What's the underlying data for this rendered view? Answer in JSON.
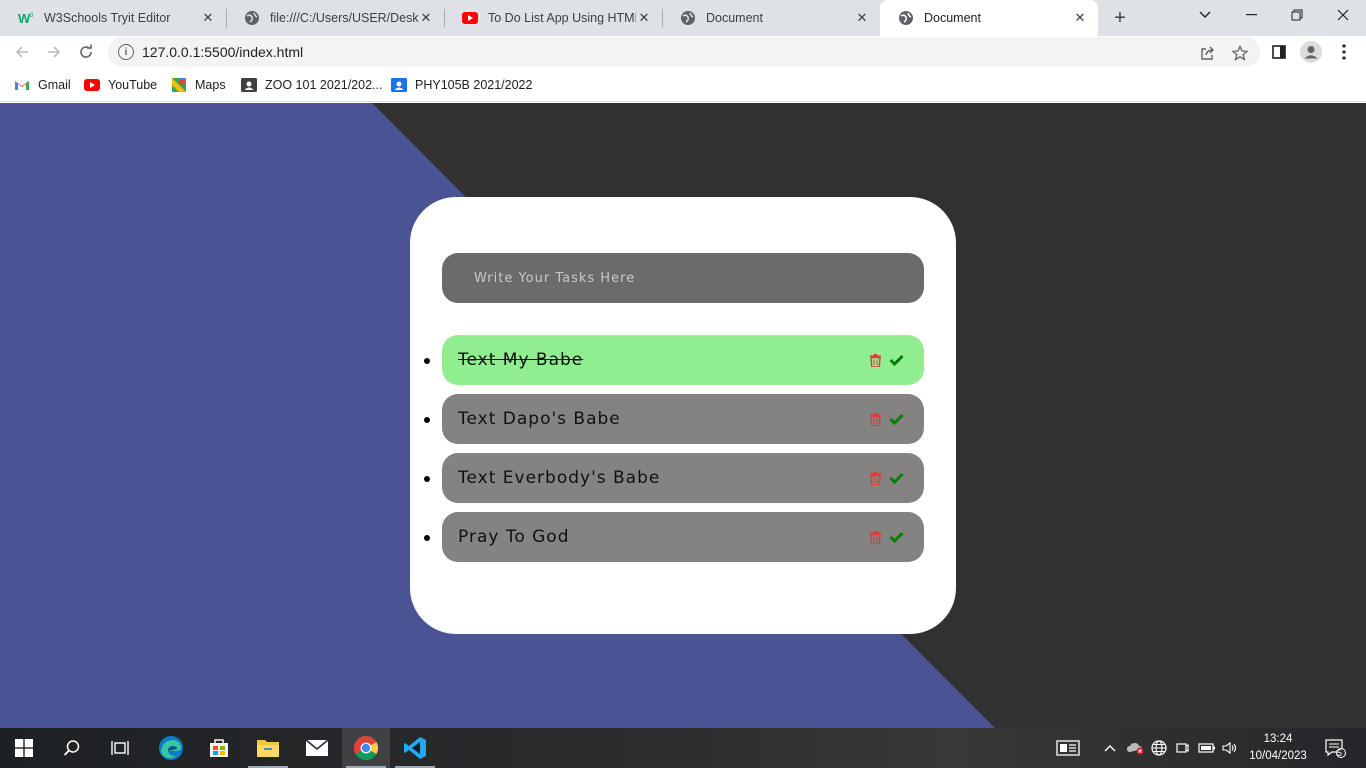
{
  "browser": {
    "tabs": [
      {
        "title": "W3Schools Tryit Editor",
        "icon": "w3schools-icon"
      },
      {
        "title": "file:///C:/Users/USER/Desktop",
        "icon": "globe-icon"
      },
      {
        "title": "To Do List App Using HTML",
        "icon": "youtube-icon"
      },
      {
        "title": "Document",
        "icon": "globe-icon"
      },
      {
        "title": "Document",
        "icon": "globe-icon"
      }
    ],
    "url": "127.0.0.1:5500/index.html",
    "bookmarks": [
      {
        "label": "Gmail",
        "icon": "gmail-icon"
      },
      {
        "label": "YouTube",
        "icon": "youtube-icon"
      },
      {
        "label": "Maps",
        "icon": "maps-icon"
      },
      {
        "label": "ZOO 101 2021/202...",
        "icon": "classroom-icon"
      },
      {
        "label": "PHY105B 2021/2022",
        "icon": "classroom-icon"
      }
    ]
  },
  "app": {
    "input_placeholder": "Write Your Tasks Here",
    "tasks": [
      {
        "text": "Text My Babe",
        "completed": true
      },
      {
        "text": "Text Dapo's Babe",
        "completed": false
      },
      {
        "text": "Text Everbody's Babe",
        "completed": false
      },
      {
        "text": "Pray To God",
        "completed": false
      }
    ],
    "colors": {
      "background_blue": "#4a5494",
      "background_dark": "#313131",
      "card": "#ffffff",
      "input_bg": "#6b6b6b",
      "task_bg": "#858282",
      "task_done_bg": "#90ee90",
      "delete_icon": "#e53935",
      "check_icon": "#008000"
    }
  },
  "taskbar": {
    "time": "13:24",
    "date": "10/04/2023",
    "notification_count": "5"
  }
}
